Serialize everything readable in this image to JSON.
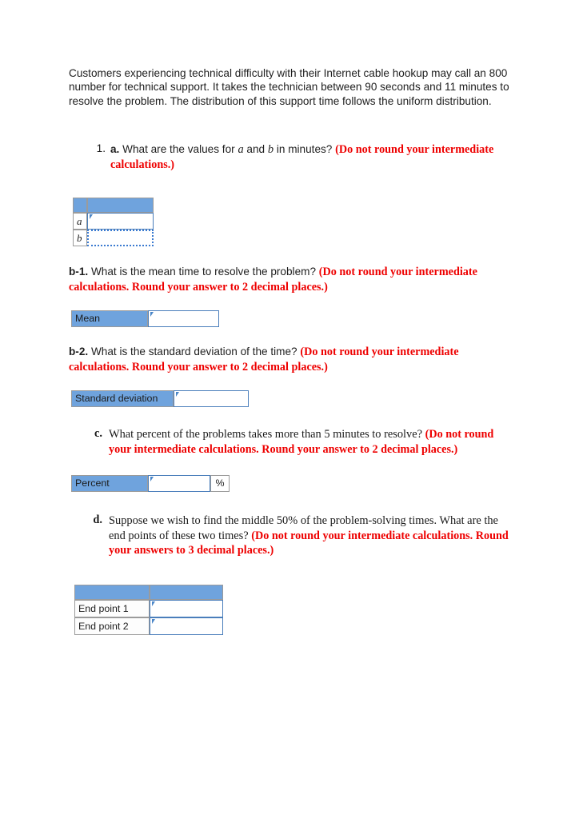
{
  "document": {
    "intro": "Customers experiencing technical difficulty with their Internet cable hookup may call an 800 number for technical support. It takes the technician between 90 seconds and 11 minutes to resolve the problem. The distribution of this support time follows the uniform distribution."
  },
  "question_a": {
    "number": "1.",
    "letter": "a.",
    "text_before_var1": " What are the values for ",
    "var1": "a",
    "text_between": " and ",
    "var2": "b",
    "text_after": " in minutes? ",
    "note": "(Do not round your intermediate calculations.)"
  },
  "question_b1": {
    "letter": "b-1.",
    "text": " What is the mean time to resolve the problem? ",
    "note": "(Do not round your intermediate calculations. Round your answer to 2 decimal places.)"
  },
  "question_b2": {
    "letter": "b-2.",
    "text": " What is the standard deviation of the time? ",
    "note": "(Do not round your intermediate calculations. Round your answer to 2 decimal places.)"
  },
  "question_c": {
    "letter": "c.",
    "text": "What percent of the problems takes more than 5 minutes to resolve? ",
    "note": "(Do not round your intermediate calculations. Round your answer to 2 decimal places.)"
  },
  "question_d": {
    "letter": "d.",
    "text": "Suppose we wish to find the middle 50% of the problem-solving times. What are the end points of these two times? ",
    "note": "(Do not round your intermediate calculations. Round your answers to 3 decimal places.)"
  },
  "answers": {
    "ab_table": {
      "header_col1": "",
      "header_col2": "",
      "rows": [
        {
          "label": "a",
          "value": "",
          "state": "focused"
        },
        {
          "label": "b",
          "value": "",
          "state": "selected"
        }
      ]
    },
    "mean_row": {
      "label": "Mean",
      "value": ""
    },
    "sd_row": {
      "label": "Standard deviation",
      "value": ""
    },
    "percent_row": {
      "label": "Percent",
      "value": "",
      "suffix": "%"
    },
    "endpoints_table": {
      "header_col1": "",
      "header_col2": "",
      "rows": [
        {
          "label": "End point 1",
          "value": ""
        },
        {
          "label": "End point 2",
          "value": ""
        }
      ]
    }
  },
  "colors": {
    "header_blue": "#6fa3dd",
    "input_border_blue": "#4a7ebb",
    "selection_blue": "#3a7ad0",
    "note_red": "#ee0000",
    "cell_border_gray": "#9b9b9b",
    "page_background": "#ffffff",
    "text": "#1e1e1e"
  }
}
